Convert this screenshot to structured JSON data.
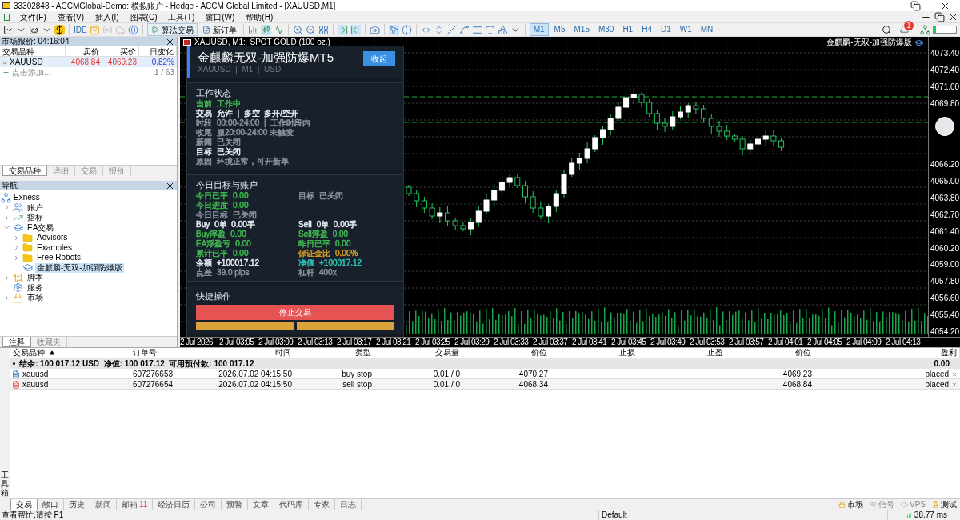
{
  "window": {
    "title": "33302848 - ACCMGlobal-Demo: 模拟账户 - Hedge - ACCM Global Limited - [XAUUSD,M1]"
  },
  "menu": [
    "文件(F)",
    "查看(V)",
    "插入(I)",
    "图表(C)",
    "工具(T)",
    "窗口(W)",
    "帮助(H)"
  ],
  "toolbar": {
    "ide_label": "IDE",
    "algo_trading": "算法交易",
    "new_order": "新订单",
    "notification_count": "1",
    "timeframes": [
      {
        "label": "M1",
        "selected": true
      },
      {
        "label": "M5",
        "selected": false
      },
      {
        "label": "M15",
        "selected": false
      },
      {
        "label": "M30",
        "selected": false
      },
      {
        "label": "H1",
        "selected": false
      },
      {
        "label": "H4",
        "selected": false
      },
      {
        "label": "D1",
        "selected": false
      },
      {
        "label": "W1",
        "selected": false
      },
      {
        "label": "MN",
        "selected": false
      }
    ]
  },
  "market_watch": {
    "title": "市场报价: 04:16:04",
    "columns": [
      "交易品种",
      "卖价",
      "买价",
      "日变化"
    ],
    "rows": [
      {
        "symbol": "XAUUSD",
        "bid": "4068.84",
        "ask": "4069.23",
        "change": "0.82%",
        "selected": true
      }
    ],
    "add_label": "点击添加...",
    "count": "1 / 63",
    "tabs": [
      {
        "label": "交易品种",
        "selected": true
      },
      {
        "label": "详细",
        "selected": false
      },
      {
        "label": "交易",
        "selected": false
      },
      {
        "label": "报价",
        "selected": false
      }
    ]
  },
  "navigator": {
    "title": "导航",
    "tree": [
      {
        "label": "Exness",
        "children": [
          {
            "label": "账户",
            "kind": "accounts",
            "expanded": false
          },
          {
            "label": "指标",
            "kind": "indicators",
            "expanded": false
          },
          {
            "label": "EA交易",
            "kind": "experts",
            "expanded": true,
            "children": [
              {
                "label": "Advisors",
                "kind": "folder",
                "expanded": false
              },
              {
                "label": "Examples",
                "kind": "folder",
                "expanded": false
              },
              {
                "label": "Free Robots",
                "kind": "folder",
                "expanded": false
              },
              {
                "label": "金麒麟-无双-加强防爆版",
                "kind": "expert",
                "selected": true
              }
            ]
          },
          {
            "label": "脚本",
            "kind": "scripts",
            "expanded": false
          },
          {
            "label": "服务",
            "kind": "services"
          },
          {
            "label": "市场",
            "kind": "market",
            "expanded": false
          }
        ]
      }
    ],
    "tabs": [
      {
        "label": "注释",
        "selected": true
      },
      {
        "label": "收藏夹",
        "selected": false
      }
    ]
  },
  "chart": {
    "title": "XAUUSD, M1:  SPOT GOLD (100 oz.)",
    "ea_name": "金麒麟-无双-加强防爆版",
    "price_labels": [
      "4073.40",
      "4072.40",
      "4071.00",
      "4069.80",
      "4066.20",
      "4065.00",
      "4063.80",
      "4062.70",
      "4061.40",
      "4060.20",
      "4059.00",
      "4057.80",
      "4056.60",
      "4055.40",
      "4054.20"
    ],
    "time_labels": [
      "2 Jul 2026",
      "2 Jul 03:05",
      "2 Jul 03:09",
      "2 Jul 03:13",
      "2 Jul 03:17",
      "2 Jul 03:21",
      "2 Jul 03:25",
      "2 Jul 03:29",
      "2 Jul 03:33",
      "2 Jul 03:37",
      "2 Jul 03:41",
      "2 Jul 03:45",
      "2 Jul 03:49",
      "2 Jul 03:53",
      "2 Jul 03:57",
      "2 Jul 04:01",
      "2 Jul 04:05",
      "2 Jul 04:09",
      "2 Jul 04:13"
    ]
  },
  "ea_panel": {
    "title": "金麒麟无双-加强防爆MT5",
    "subtitle": "XAUUSD  |  M1  |  USD",
    "collapse_button": "收起",
    "status": {
      "title": "工作状态",
      "lines": [
        {
          "label": "当前",
          "value": "工作中",
          "color": "#3fb950"
        },
        {
          "label": "交易",
          "value": "允许  |  多空  多开/空开",
          "color": "#e6edf3"
        },
        {
          "label": "时段",
          "value": "00:00-24:00  |  工作时段内",
          "color": "#8b949e"
        },
        {
          "label": "收尾",
          "value": "服20:00-24:00 未触发",
          "color": "#8b949e"
        },
        {
          "label": "新闻",
          "value": "已关闭",
          "color": "#8b949e"
        },
        {
          "label": "目标",
          "value": "已关闭",
          "color": "#e6edf3"
        },
        {
          "label": "原因",
          "value": "环境正常，可开新单",
          "color": "#8b949e"
        }
      ]
    },
    "account": {
      "title": "今日目标与账户",
      "rows": [
        [
          {
            "label": "今日已平",
            "value": "0.00",
            "color": "#3fb950"
          },
          {
            "label": "目标",
            "value": "已关闭",
            "color": "#8b949e"
          }
        ],
        [
          {
            "label": "今日进度",
            "value": "0.00",
            "color": "#3fb950"
          }
        ],
        [
          {
            "label": "今日目标",
            "value": "已关闭",
            "color": "#8b949e"
          }
        ],
        [
          {
            "label": "Buy",
            "value": "0单  0.00手",
            "color": "#e6edf3"
          },
          {
            "label": "Sell",
            "value": "0单  0.00手",
            "color": "#e6edf3"
          }
        ],
        [
          {
            "label": "Buy浮盈",
            "value": "0.00",
            "color": "#3fb950"
          },
          {
            "label": "Sell浮盈",
            "value": "0.00",
            "color": "#3fb950"
          }
        ],
        [
          {
            "label": "EA浮盈亏",
            "value": "0.00",
            "color": "#3fb950"
          },
          {
            "label": "昨日已平",
            "value": "0.00",
            "color": "#3fb950"
          }
        ],
        [
          {
            "label": "累计已平",
            "value": "0.00",
            "color": "#3fb950"
          },
          {
            "label": "保证金比",
            "value": "0.00%",
            "color": "#d29922"
          }
        ],
        [
          {
            "label": "余额",
            "value": "+100017.12",
            "color": "#e6edf3"
          },
          {
            "label": "净值",
            "value": "+100017.12",
            "color": "#2ec4b6"
          }
        ],
        [
          {
            "label": "点差",
            "value": "39.0 pips",
            "color": "#8b949e"
          },
          {
            "label": "杠杆",
            "value": "400x",
            "color": "#8b949e"
          }
        ]
      ]
    },
    "quick": {
      "title": "快捷操作",
      "stop_button": "停止交易"
    }
  },
  "toolbox": {
    "label": "工具箱",
    "columns": [
      "交易品种",
      "订单号",
      "时间",
      "类型",
      "交易量",
      "价位",
      "止损",
      "止盈",
      "价位",
      "盈利"
    ],
    "summary": "结余: 100 017.12 USD  净值: 100 017.12  可用预付款: 100 017.12",
    "summary_profit": "0.00",
    "orders": [
      {
        "kind": "buy",
        "symbol": "xauusd",
        "ticket": "607276653",
        "time": "2026.07.02 04:15:50",
        "type": "buy stop",
        "volume": "0.01 / 0",
        "price": "4070.27",
        "current": "4069.23",
        "profit": "placed"
      },
      {
        "kind": "sell",
        "symbol": "xauusd",
        "ticket": "607276654",
        "time": "2026.07.02 04:15:50",
        "type": "sell stop",
        "volume": "0.01 / 0",
        "price": "4068.34",
        "current": "4068.84",
        "profit": "placed"
      }
    ],
    "tabs": [
      {
        "label": "交易",
        "selected": true
      },
      {
        "label": "敞口",
        "selected": false
      },
      {
        "label": "历史",
        "selected": false
      },
      {
        "label": "新闻",
        "selected": false
      },
      {
        "label": "邮箱",
        "badge": "11",
        "selected": false
      },
      {
        "label": "经济日历",
        "selected": false
      },
      {
        "label": "公司",
        "selected": false
      },
      {
        "label": "预警",
        "selected": false
      },
      {
        "label": "文章",
        "selected": false
      },
      {
        "label": "代码库",
        "selected": false
      },
      {
        "label": "专家",
        "selected": false
      },
      {
        "label": "日志",
        "selected": false
      }
    ],
    "right_tabs": [
      {
        "label": "市场",
        "kind": "market",
        "disabled": false
      },
      {
        "label": "信号",
        "kind": "signals",
        "disabled": true
      },
      {
        "label": "VPS",
        "kind": "vps",
        "disabled": true
      },
      {
        "label": "测试",
        "kind": "tester",
        "disabled": false
      }
    ]
  },
  "status_bar": {
    "help": "查看帮忙,请按 F1",
    "profile": "Default",
    "ping": "38.77 ms"
  }
}
